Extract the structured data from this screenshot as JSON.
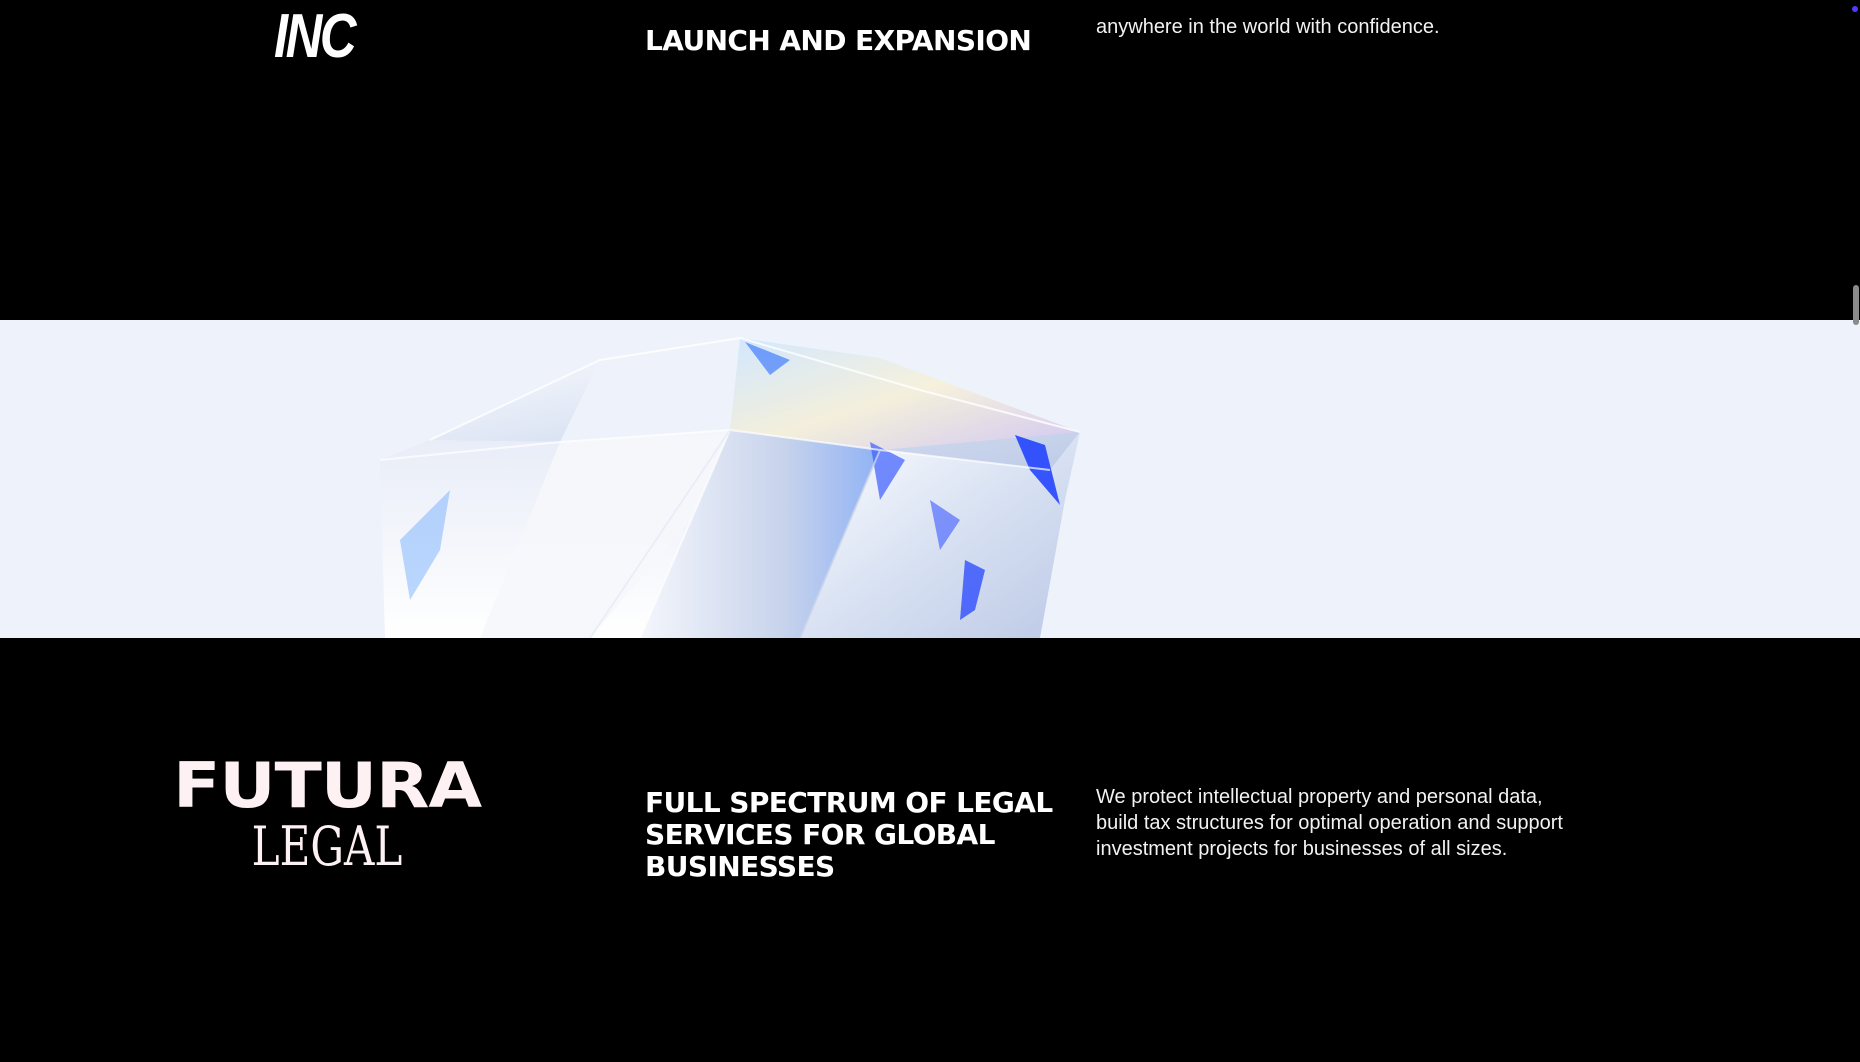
{
  "top_block": {
    "logo_text": "INC",
    "heading": "LAUNCH AND EXPANSION",
    "description": "anywhere in the world with confidence."
  },
  "bottom_block": {
    "logo_line1": "FUTURA",
    "logo_line2": "LEGAL",
    "heading": "FULL SPECTRUM OF LEGAL SERVICES FOR GLOBAL BUSINESSES",
    "description": "We protect intellectual property and personal data, build tax structures for optimal operation and support investment projects for businesses of all sizes."
  },
  "colors": {
    "background": "#000000",
    "band_background": "#eef2fb",
    "logo_pink": "#fdf1f3",
    "accent_blue": "#1a3cff"
  }
}
